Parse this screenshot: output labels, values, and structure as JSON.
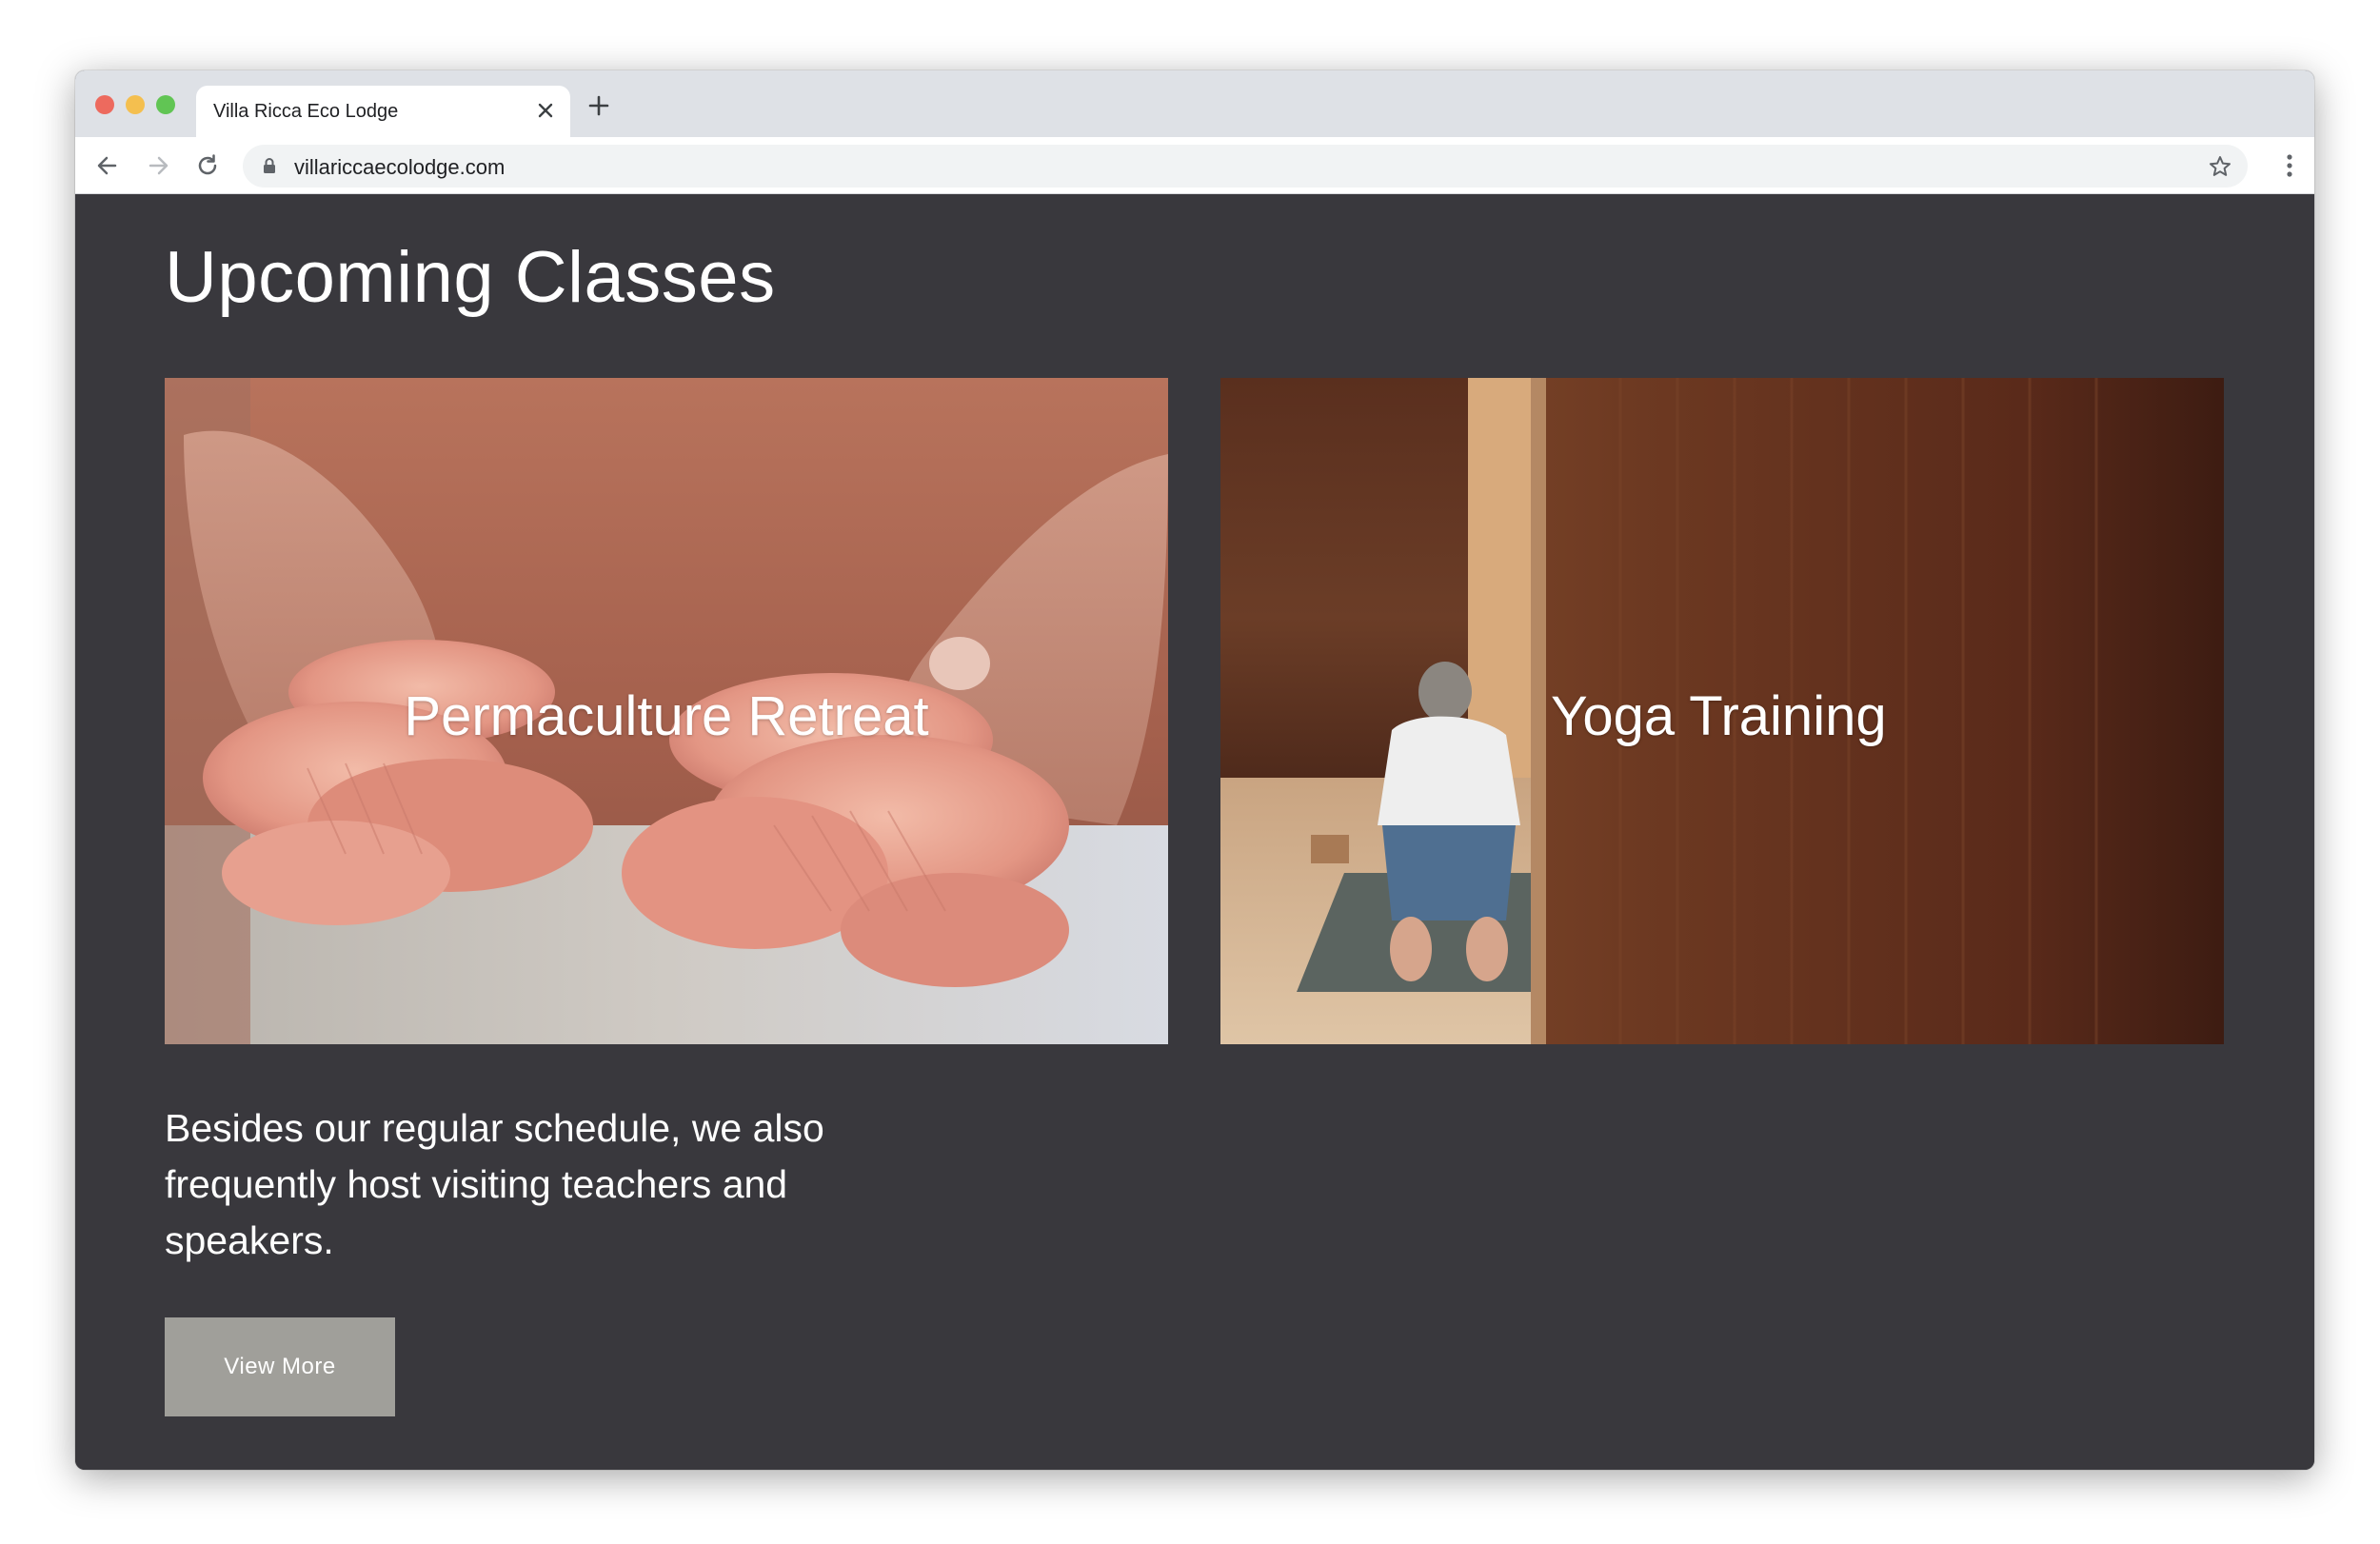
{
  "browser": {
    "tab_title": "Villa Ricca Eco Lodge",
    "url": "villariccaecolodge.com",
    "icons": {
      "close_tab": "close-icon",
      "new_tab": "plus-icon",
      "back": "arrow-left-icon",
      "forward": "arrow-right-icon",
      "reload": "reload-icon",
      "secure": "lock-icon",
      "bookmark": "star-icon",
      "menu": "kebab-menu-icon"
    },
    "traffic_lights": [
      "#ed6a5e",
      "#f4bf4f",
      "#61c554"
    ]
  },
  "page": {
    "background_color": "#39383d",
    "heading": "Upcoming Classes",
    "cards": [
      {
        "title": "Permaculture Retreat",
        "image": "hands holding pink oyster mushrooms"
      },
      {
        "title": "Yoga Training",
        "image": "person stretching on yoga mat in wooden room"
      }
    ],
    "description": "Besides our regular schedule, we also frequently host visiting teachers and speakers.",
    "button_label": "View More",
    "button_color": "#a09f9a"
  }
}
